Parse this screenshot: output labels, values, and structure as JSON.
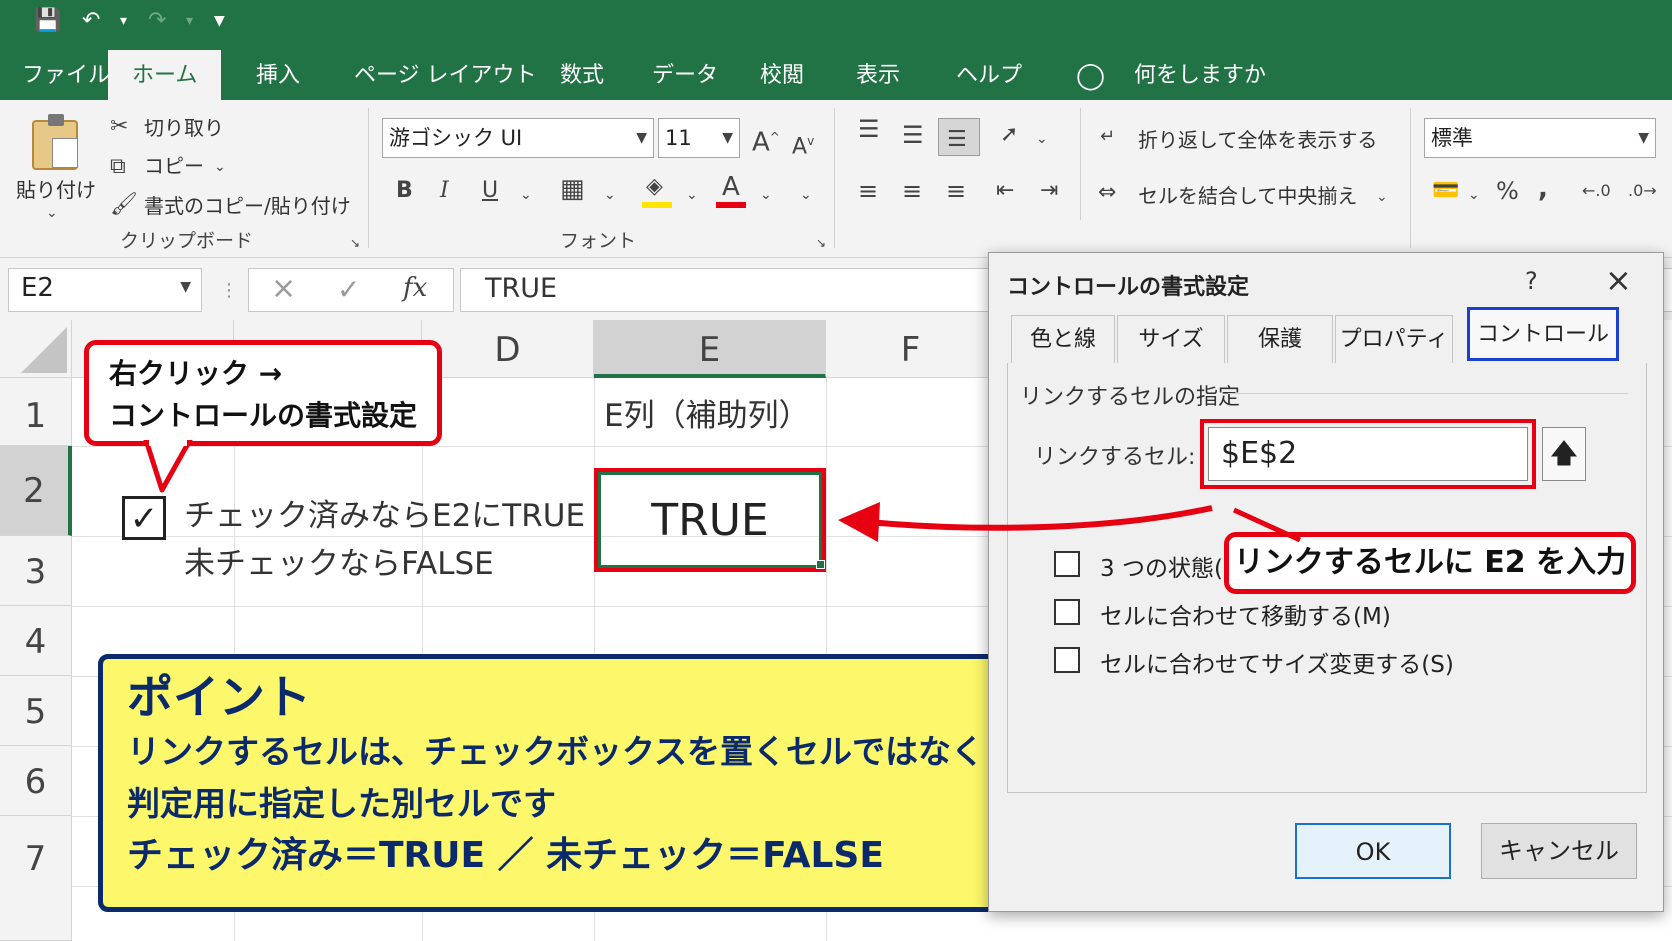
{
  "quick_access": {
    "save_icon": "save-icon",
    "undo_icon": "undo-icon",
    "redo_icon": "redo-icon",
    "customize_icon": "customize-icon"
  },
  "menu": {
    "tabs": [
      "ファイル",
      "ホーム",
      "挿入",
      "ページ レイアウト",
      "数式",
      "データ",
      "校閲",
      "表示",
      "ヘルプ"
    ],
    "active_tab": "ホーム",
    "tell_me": "何をしますか"
  },
  "ribbon": {
    "clipboard": {
      "paste": "貼り付け",
      "cut": "切り取り",
      "copy": "コピー",
      "format_painter": "書式のコピー/貼り付け",
      "label": "クリップボード"
    },
    "font": {
      "name": "游ゴシック UI",
      "size": "11",
      "label": "フォント",
      "bold": "B",
      "italic": "I",
      "underline": "U",
      "grow": "A",
      "shrink": "A",
      "font_color": "A"
    },
    "alignment": {
      "wrap_text": "折り返して全体を表示する",
      "merge_center": "セルを結合して中央揃え"
    },
    "number": {
      "format": "標準",
      "percent": "%",
      "comma": ","
    }
  },
  "formula_bar": {
    "name_box": "E2",
    "cancel": "×",
    "enter": "✓",
    "fx": "fx",
    "value": "TRUE"
  },
  "sheet": {
    "columns": [
      "D",
      "E",
      "F"
    ],
    "rows": [
      "1",
      "2",
      "3",
      "4",
      "5",
      "6",
      "7"
    ],
    "e1_text": "E列（補助列）",
    "e2_value": "TRUE",
    "checkbox_label_line1": "チェック済みならE2にTRUE",
    "checkbox_label_line2": "未チェックならFALSE",
    "checkbox_checked": true
  },
  "callout_right_click": {
    "line1": "右クリック →",
    "line2": "コントロールの書式設定"
  },
  "point_box": {
    "title": "ポイント",
    "line1": "リンクするセルは、チェックボックスを置くセルではなく",
    "line2": "判定用に指定した別セルです",
    "line3": "チェック済み＝TRUE ／ 未チェック＝FALSE",
    "bg_color": "#fdf76b",
    "border_color": "#0b2a6b",
    "text_color": "#0b2a6b"
  },
  "dialog": {
    "title": "コントロールの書式設定",
    "help": "?",
    "close": "×",
    "tabs": [
      "色と線",
      "サイズ",
      "保護",
      "プロパティ",
      "コントロール"
    ],
    "active_tab": "コントロール",
    "section": "リンクするセルの指定",
    "linked_cell_label": "リンクするセル:",
    "linked_cell_value": "$E$2",
    "options": [
      {
        "label": "3 つの状態(1)",
        "checked": false
      },
      {
        "label": "セルに合わせて移動する(M)",
        "checked": false
      },
      {
        "label": "セルに合わせてサイズ変更する(S)",
        "checked": false
      }
    ],
    "ok": "OK",
    "cancel": "キャンセル"
  },
  "callout_link": {
    "text": "リンクするセルに E2 を入力"
  },
  "colors": {
    "excel_green": "#217346",
    "annotation_red": "#e60012",
    "focus_blue": "#1a3fd1"
  }
}
